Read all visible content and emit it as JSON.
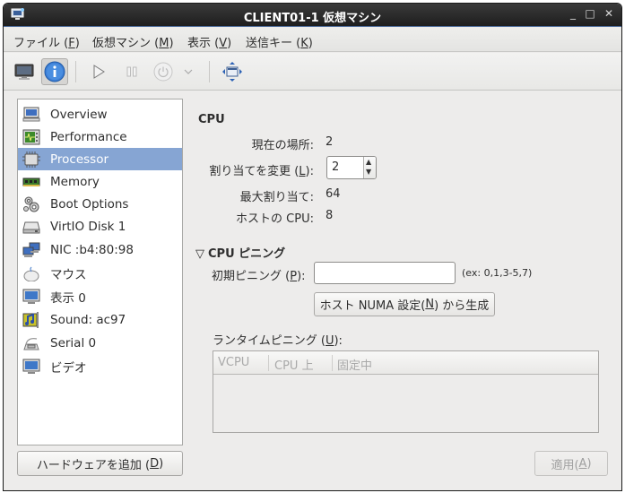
{
  "window": {
    "title": "CLIENT01-1 仮想マシン",
    "controls": {
      "minimize": "_",
      "maximize": "□",
      "close": "✕"
    }
  },
  "menubar": {
    "items": [
      {
        "label": "ファイル (",
        "mnemonic": "F",
        "suffix": ")"
      },
      {
        "label": "仮想マシン (",
        "mnemonic": "M",
        "suffix": ")"
      },
      {
        "label": "表示 (",
        "mnemonic": "V",
        "suffix": ")"
      },
      {
        "label": "送信キー (",
        "mnemonic": "K",
        "suffix": ")"
      }
    ]
  },
  "toolbar": {
    "buttons": [
      {
        "name": "console",
        "icon": "monitor-icon"
      },
      {
        "name": "details",
        "icon": "info-icon",
        "active": true
      },
      {
        "name": "run",
        "icon": "play-icon"
      },
      {
        "name": "pause",
        "icon": "pause-icon"
      },
      {
        "name": "shutdown",
        "icon": "power-icon"
      },
      {
        "name": "shutdown-menu",
        "icon": "chevron-down-icon"
      },
      {
        "name": "fullscreen",
        "icon": "resize-arrows-icon"
      }
    ]
  },
  "sidebar": {
    "selected_index": 2,
    "items": [
      {
        "label": "Overview",
        "icon": "computer-icon"
      },
      {
        "label": "Performance",
        "icon": "performance-monitor-icon"
      },
      {
        "label": "Processor",
        "icon": "cpu-chip-icon"
      },
      {
        "label": "Memory",
        "icon": "memory-module-icon"
      },
      {
        "label": "Boot Options",
        "icon": "gears-icon"
      },
      {
        "label": "VirtIO Disk 1",
        "icon": "hard-disk-icon"
      },
      {
        "label": "NIC :b4:80:98",
        "icon": "network-icon"
      },
      {
        "label": "マウス",
        "icon": "mouse-icon"
      },
      {
        "label": "表示 0",
        "icon": "display-icon"
      },
      {
        "label": "Sound: ac97",
        "icon": "sound-card-icon"
      },
      {
        "label": "Serial 0",
        "icon": "serial-port-icon"
      },
      {
        "label": "ビデオ",
        "icon": "video-icon"
      }
    ],
    "add_hardware": {
      "label": "ハードウェアを追加 (",
      "mnemonic": "D",
      "suffix": ")"
    }
  },
  "cpu": {
    "section_title": "CPU",
    "current_label": "現在の場所:",
    "current_value": "2",
    "change_label": "割り当てを変更 (",
    "change_mnemonic": "L",
    "change_suffix": "):",
    "change_value": "2",
    "max_label": "最大割り当て:",
    "max_value": "64",
    "host_label": "ホストの CPU:",
    "host_value": "8"
  },
  "pinning": {
    "section_title": "CPU ピニング",
    "expander": "▽",
    "initial_label": "初期ピニング (",
    "initial_mnemonic": "P",
    "initial_suffix": "):",
    "initial_value": "",
    "hint": "(ex: 0,1,3-5,7)",
    "generate_button": {
      "label": "ホスト NUMA 設定(",
      "mnemonic": "N",
      "suffix": ") から生成"
    },
    "runtime_label": "ランタイムピニング (",
    "runtime_mnemonic": "U",
    "runtime_suffix": "):",
    "table": {
      "columns": [
        "VCPU",
        "CPU 上",
        "固定中"
      ],
      "rows": []
    }
  },
  "apply_button": {
    "label": "適用(",
    "mnemonic": "A",
    "suffix": ")",
    "enabled": false
  },
  "colors": {
    "selection": "#86a5d3",
    "titlebar": "#1e1e1e",
    "background": "#edeceb"
  }
}
